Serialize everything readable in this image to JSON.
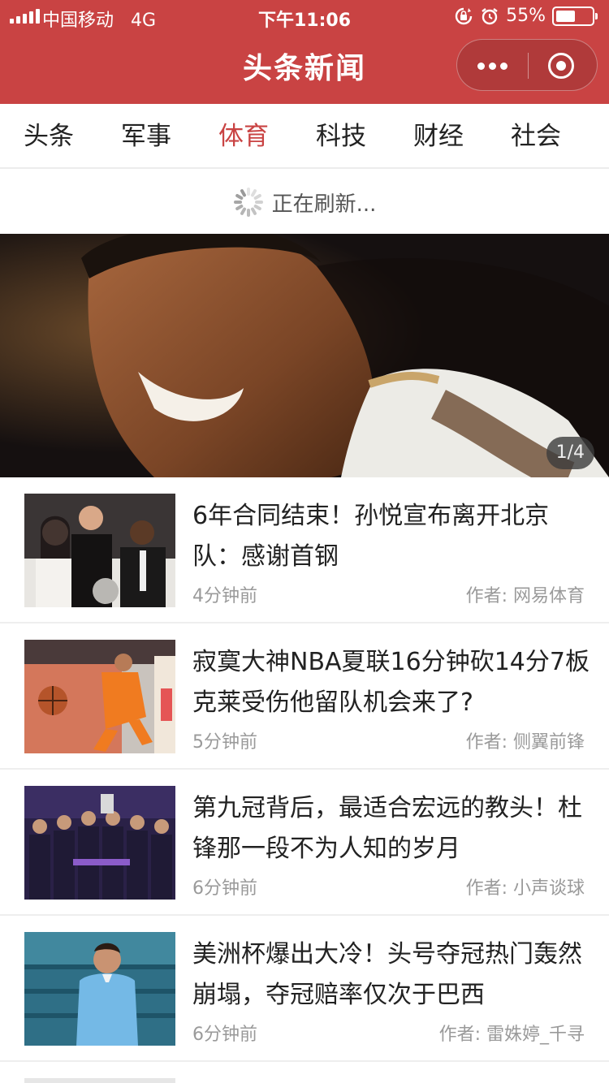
{
  "status_bar": {
    "carrier": "中国移动",
    "network": "4G",
    "time": "下午11:06",
    "battery": "55%",
    "battery_level": 0.55
  },
  "navbar": {
    "title": "头条新闻",
    "icons": [
      "more-dots-icon",
      "close-target-icon"
    ]
  },
  "tabs": [
    {
      "label": "头条",
      "active": false
    },
    {
      "label": "军事",
      "active": false
    },
    {
      "label": "体育",
      "active": true
    },
    {
      "label": "科技",
      "active": false
    },
    {
      "label": "财经",
      "active": false
    },
    {
      "label": "社会",
      "active": false
    }
  ],
  "refresh": {
    "text": "正在刷新..."
  },
  "banner": {
    "counter": "1/4"
  },
  "news": [
    {
      "title": "6年合同结束！孙悦宣布离开北京队：感谢首钢",
      "time": "4分钟前",
      "author": "作者: 网易体育"
    },
    {
      "title": "寂寞大神NBA夏联16分钟砍14分7板 克莱受伤他留队机会来了?",
      "time": "5分钟前",
      "author": "作者: 侧翼前锋"
    },
    {
      "title": "第九冠背后，最适合宏远的教头！杜锋那一段不为人知的岁月",
      "time": "6分钟前",
      "author": "作者: 小声谈球"
    },
    {
      "title": "美洲杯爆出大冷！头号夺冠热门轰然崩塌，夺冠赔率仅次于巴西",
      "time": "6分钟前",
      "author": "作者: 雷姝婷_千寻"
    }
  ],
  "colors": {
    "brand": "#c94343",
    "active_tab": "#c94343",
    "meta_text": "#9a9a9a"
  }
}
